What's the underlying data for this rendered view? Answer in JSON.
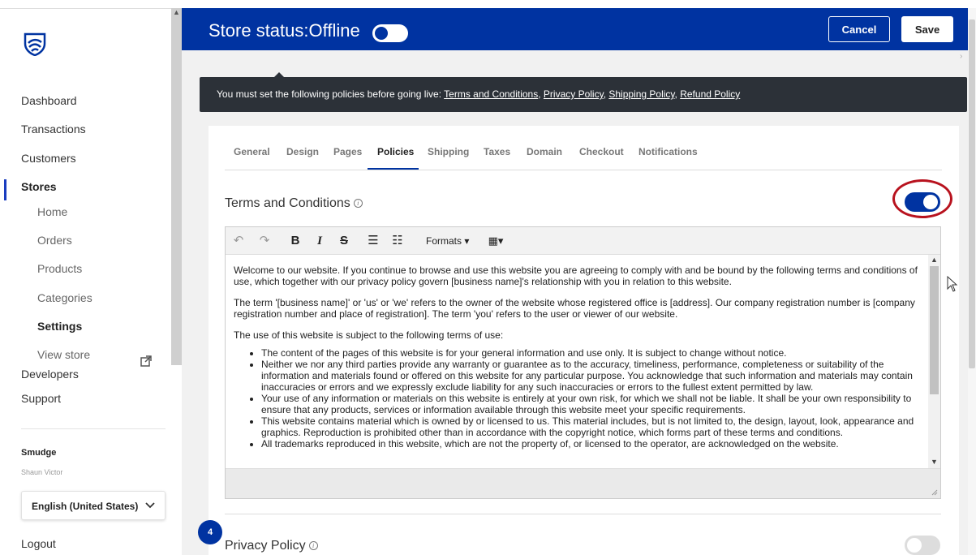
{
  "header": {
    "store_status": "Store status:Offline",
    "cancel_label": "Cancel",
    "save_label": "Save"
  },
  "sidebar": {
    "nav": [
      "Dashboard",
      "Transactions",
      "Customers",
      "Stores"
    ],
    "store_sub": [
      "Home",
      "Orders",
      "Products",
      "Categories",
      "Settings",
      "View store"
    ],
    "bottom_nav": [
      "Developers",
      "Support"
    ],
    "account_name": "Smudge",
    "account_user": "Shaun Victor",
    "language": "English (United States)",
    "logout": "Logout"
  },
  "banner": {
    "prefix": "You must set the following policies before going live: ",
    "links": [
      "Terms and Conditions",
      "Privacy Policy",
      "Shipping Policy",
      "Refund Policy"
    ]
  },
  "tabs": [
    "General",
    "Design",
    "Pages",
    "Policies",
    "Shipping",
    "Taxes",
    "Domain",
    "Checkout",
    "Notifications"
  ],
  "active_tab": "Policies",
  "terms": {
    "title": "Terms and Conditions",
    "enabled": true,
    "toolbar_formats": "Formats",
    "p1": "Welcome to our website. If you continue to browse and use this website you are agreeing to comply with and be bound by the following terms and conditions of use, which together with our privacy policy govern [business name]'s relationship with you in relation to this website.",
    "p2": "The term '[business name]' or 'us' or 'we' refers to the owner of the website whose registered office is [address]. Our company registration number is [company registration number and place of registration]. The term 'you' refers to the user or viewer of our website.",
    "p3": "The use of this website is subject to the following terms of use:",
    "bullets": [
      "The content of the pages of this website is for your general information and use only. It is subject to change without notice.",
      "Neither we nor any third parties provide any warranty or guarantee as to the accuracy, timeliness, performance, completeness or suitability of the information and materials found or offered on this website for any particular purpose. You acknowledge that such information and materials may contain inaccuracies or errors and we expressly exclude liability for any such inaccuracies or errors to the fullest extent permitted by law.",
      "Your use of any information or materials on this website is entirely at your own risk, for which we shall not be liable. It shall be your own responsibility to ensure that any products, services or information available through this website meet your specific requirements.",
      "This website contains material which is owned by or licensed to us. This material includes, but is not limited to, the design, layout, look, appearance and graphics. Reproduction is prohibited other than in accordance with the copyright notice, which forms part of these terms and conditions.",
      "All trademarks reproduced in this website, which are not the property of, or licensed to the operator, are acknowledged on the website."
    ]
  },
  "privacy": {
    "title": "Privacy Policy",
    "enabled": false
  },
  "step_badge": "4",
  "colors": {
    "brand_blue": "#0033a1",
    "banner_bg": "#2c3138",
    "highlight_red": "#b8121e"
  }
}
